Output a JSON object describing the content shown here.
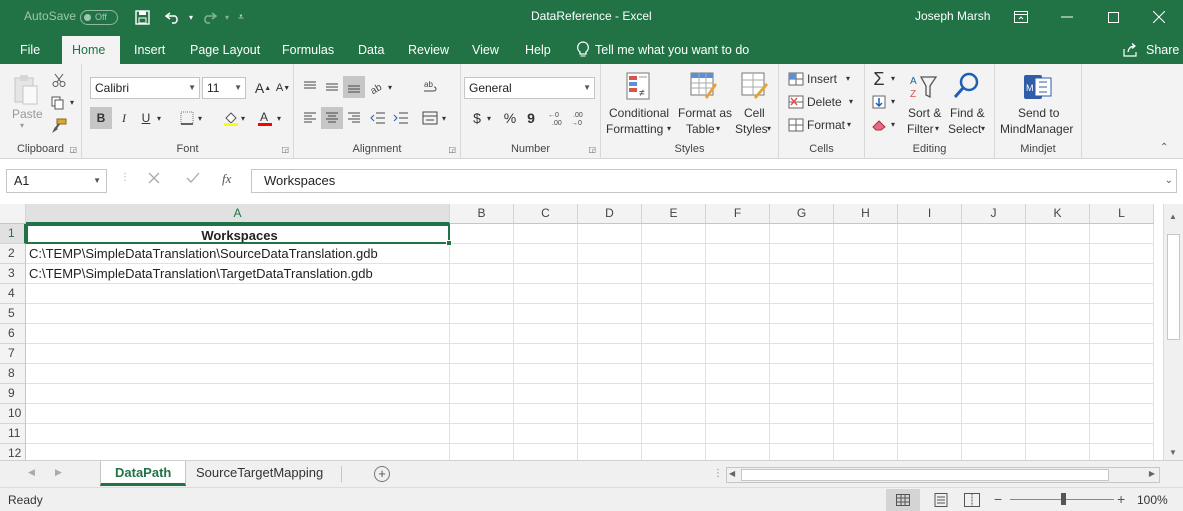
{
  "titlebar": {
    "autosave_label": "AutoSave",
    "autosave_state": "Off",
    "title": "DataReference  -  Excel",
    "user": "Joseph Marsh"
  },
  "tabs": [
    "File",
    "Home",
    "Insert",
    "Page Layout",
    "Formulas",
    "Data",
    "Review",
    "View",
    "Help"
  ],
  "tell_me": "Tell me what you want to do",
  "share": "Share",
  "ribbon": {
    "clipboard": {
      "label": "Clipboard",
      "paste": "Paste"
    },
    "font": {
      "label": "Font",
      "name": "Calibri",
      "size": "11",
      "bold": "B",
      "italic": "I",
      "underline": "U"
    },
    "alignment": {
      "label": "Alignment"
    },
    "number": {
      "label": "Number",
      "format": "General",
      "currency": "$",
      "percent": "%",
      "comma": "9"
    },
    "styles": {
      "label": "Styles",
      "conditional1": "Conditional",
      "conditional2": "Formatting",
      "format_as1": "Format as",
      "format_as2": "Table",
      "cell1": "Cell",
      "cell2": "Styles"
    },
    "cells": {
      "label": "Cells",
      "insert": "Insert",
      "delete": "Delete",
      "format": "Format"
    },
    "editing": {
      "label": "Editing",
      "sort1": "Sort &",
      "sort2": "Filter",
      "find1": "Find &",
      "find2": "Select"
    },
    "mindjet": {
      "label": "Mindjet",
      "send1": "Send to",
      "send2": "MindManager"
    }
  },
  "formula_bar": {
    "name_box": "A1",
    "fx": "fx",
    "value": "Workspaces"
  },
  "grid": {
    "columns": [
      "A",
      "B",
      "C",
      "D",
      "E",
      "F",
      "G",
      "H",
      "I",
      "J",
      "K",
      "L"
    ],
    "rows": [
      "1",
      "2",
      "3",
      "4",
      "5",
      "6",
      "7",
      "8",
      "9",
      "10",
      "11",
      "12"
    ],
    "cells": {
      "a1": "Workspaces",
      "a2": "C:\\TEMP\\SimpleDataTranslation\\SourceDataTranslation.gdb",
      "a3": "C:\\TEMP\\SimpleDataTranslation\\TargetDataTranslation.gdb"
    }
  },
  "sheets": [
    "DataPath",
    "SourceTargetMapping"
  ],
  "status": {
    "ready": "Ready",
    "zoom": "100%"
  },
  "colors": {
    "accent": "#217346"
  }
}
